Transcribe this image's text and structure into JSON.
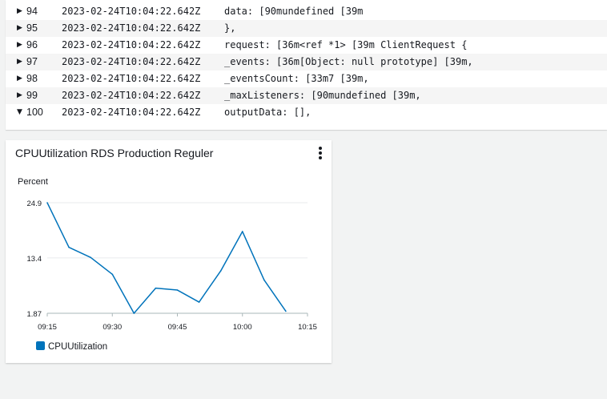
{
  "log": {
    "rows": [
      {
        "num": "94",
        "timestamp": "2023-02-24T10:04:22.642Z",
        "message": "data: [90mundefined [39m",
        "expanded": false
      },
      {
        "num": "95",
        "timestamp": "2023-02-24T10:04:22.642Z",
        "message": "},",
        "expanded": false
      },
      {
        "num": "96",
        "timestamp": "2023-02-24T10:04:22.642Z",
        "message": "request: [36m<ref *1> [39m ClientRequest {",
        "expanded": false
      },
      {
        "num": "97",
        "timestamp": "2023-02-24T10:04:22.642Z",
        "message": "_events: [36m[Object: null prototype] [39m,",
        "expanded": false
      },
      {
        "num": "98",
        "timestamp": "2023-02-24T10:04:22.642Z",
        "message": "_eventsCount: [33m7 [39m,",
        "expanded": false
      },
      {
        "num": "99",
        "timestamp": "2023-02-24T10:04:22.642Z",
        "message": "_maxListeners: [90mundefined [39m,",
        "expanded": false
      },
      {
        "num": "100",
        "timestamp": "2023-02-24T10:04:22.642Z",
        "message": "outputData: [],",
        "expanded": true
      }
    ]
  },
  "widget": {
    "title": "CPUUtilization RDS Production Reguler",
    "menu_icon": "vertical-ellipsis-icon"
  },
  "chart_data": {
    "type": "line",
    "ylabel": "Percent",
    "y_ticks": [
      "24.9",
      "13.4",
      "1.87"
    ],
    "ylim": [
      1.87,
      24.9
    ],
    "x_ticks": [
      "09:15",
      "09:30",
      "09:45",
      "10:00",
      "10:15"
    ],
    "grid": true,
    "legend_position": "bottom-left",
    "series": [
      {
        "name": "CPUUtilization",
        "color": "#0073bb",
        "points": [
          {
            "x": "09:15",
            "y": 24.9
          },
          {
            "x": "09:20",
            "y": 15.6
          },
          {
            "x": "09:25",
            "y": 13.5
          },
          {
            "x": "09:30",
            "y": 10.0
          },
          {
            "x": "09:35",
            "y": 1.87
          },
          {
            "x": "09:40",
            "y": 7.1
          },
          {
            "x": "09:45",
            "y": 6.7
          },
          {
            "x": "09:50",
            "y": 4.2
          },
          {
            "x": "09:55",
            "y": 10.7
          },
          {
            "x": "10:00",
            "y": 18.9
          },
          {
            "x": "10:05",
            "y": 8.8
          },
          {
            "x": "10:10",
            "y": 2.3
          }
        ]
      }
    ]
  }
}
